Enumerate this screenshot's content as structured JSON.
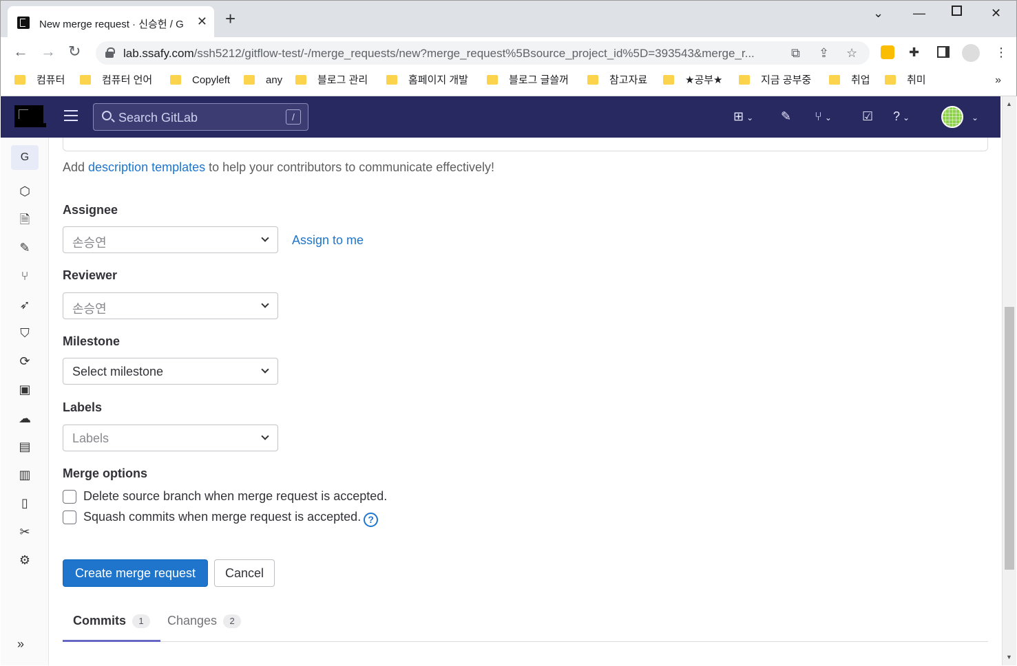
{
  "browser": {
    "tab_title": "New merge request · 신승헌 / G",
    "url_host": "lab.ssafy.com",
    "url_path": "/ssh5212/gitflow-test/-/merge_requests/new?merge_request%5Bsource_project_id%5D=393543&merge_r...",
    "bookmarks": [
      "컴퓨터",
      "컴퓨터 언어",
      "Copyleft",
      "any",
      "블로그 관리",
      "홈페이지 개발",
      "블로그 글쓸꺼",
      "참고자료",
      "★공부★",
      "지금 공부중",
      "취업",
      "취미"
    ],
    "bookmarks_more": "»"
  },
  "gitlab_header": {
    "search_placeholder": "Search GitLab",
    "search_shortcut": "/"
  },
  "sidebar": {
    "project_initial": "G"
  },
  "form": {
    "description_help_prefix": "Add ",
    "description_help_link": "description templates",
    "description_help_suffix": " to help your contributors to communicate effectively!",
    "assignee_label": "Assignee",
    "assignee_value": "손승연",
    "assign_to_me": "Assign to me",
    "reviewer_label": "Reviewer",
    "reviewer_value": "손승연",
    "milestone_label": "Milestone",
    "milestone_value": "Select milestone",
    "labels_label": "Labels",
    "labels_value": "Labels",
    "merge_options_label": "Merge options",
    "option_delete_branch": "Delete source branch when merge request is accepted.",
    "option_squash": "Squash commits when merge request is accepted.",
    "create_button": "Create merge request",
    "cancel_button": "Cancel"
  },
  "mr_tabs": [
    {
      "label": "Commits",
      "count": "1",
      "active": true
    },
    {
      "label": "Changes",
      "count": "2",
      "active": false
    }
  ]
}
